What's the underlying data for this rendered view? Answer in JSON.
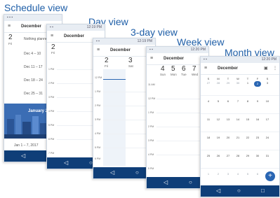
{
  "labels": {
    "schedule": "Schedule view",
    "day": "Day view",
    "three_day": "3-day view",
    "week": "Week view",
    "month": "Month view"
  },
  "status": {
    "time": "12:19 PM",
    "time_late": "12:20 PM"
  },
  "schedule": {
    "month": "December",
    "day_num": "2",
    "day_wk": "Fri",
    "nothing": "Nothing planned",
    "weeks": [
      "Dec 4 – 10",
      "Dec 11 – 17",
      "Dec 18 – 24",
      "Dec 25 – 31"
    ],
    "banner": "January 2017",
    "week_after": "Jan 1 – 7, 2017"
  },
  "day": {
    "month": "December",
    "day_num": "2",
    "day_wk": "Fri",
    "hours": [
      "1 PM",
      "2 PM",
      "3 PM",
      "4 PM",
      "5 PM",
      "6 PM",
      "7 PM"
    ]
  },
  "three_day": {
    "month": "December",
    "days": [
      {
        "num": "2",
        "wk": "Fri"
      },
      {
        "num": "3",
        "wk": "Sat"
      }
    ],
    "hours": [
      "12 PM",
      "1 PM",
      "2 PM",
      "3 PM",
      "4 PM",
      "5 PM",
      "6 PM",
      "7 PM"
    ]
  },
  "week": {
    "month": "December",
    "days": [
      {
        "num": "4",
        "wk": "Sun"
      },
      {
        "num": "5",
        "wk": "Mon"
      },
      {
        "num": "6",
        "wk": "Tue"
      },
      {
        "num": "7",
        "wk": "Wed"
      }
    ],
    "hours": [
      "11 AM",
      "12 PM",
      "1 PM",
      "2 PM",
      "3 PM",
      "4 PM",
      "5 PM",
      "6 PM"
    ]
  },
  "month": {
    "title": "December",
    "weekdays": [
      "S",
      "M",
      "T",
      "W",
      "T",
      "F",
      "S"
    ],
    "rows": [
      [
        "27",
        "28",
        "29",
        "30",
        "1",
        "2",
        "3"
      ],
      [
        "4",
        "5",
        "6",
        "7",
        "8",
        "9",
        "10"
      ],
      [
        "11",
        "12",
        "13",
        "14",
        "15",
        "16",
        "17"
      ],
      [
        "18",
        "19",
        "20",
        "21",
        "22",
        "23",
        "24"
      ],
      [
        "25",
        "26",
        "27",
        "28",
        "29",
        "30",
        "31"
      ],
      [
        "1",
        "2",
        "3",
        "4",
        "5",
        "6",
        "7"
      ]
    ],
    "fab": "+"
  },
  "nav": {
    "back": "◁",
    "home": "○",
    "recent": "□"
  },
  "colors": {
    "label": "#1f5fa8",
    "nav": "#0f3e78",
    "accent": "#2a66b3",
    "banner": "#3b6db4"
  }
}
